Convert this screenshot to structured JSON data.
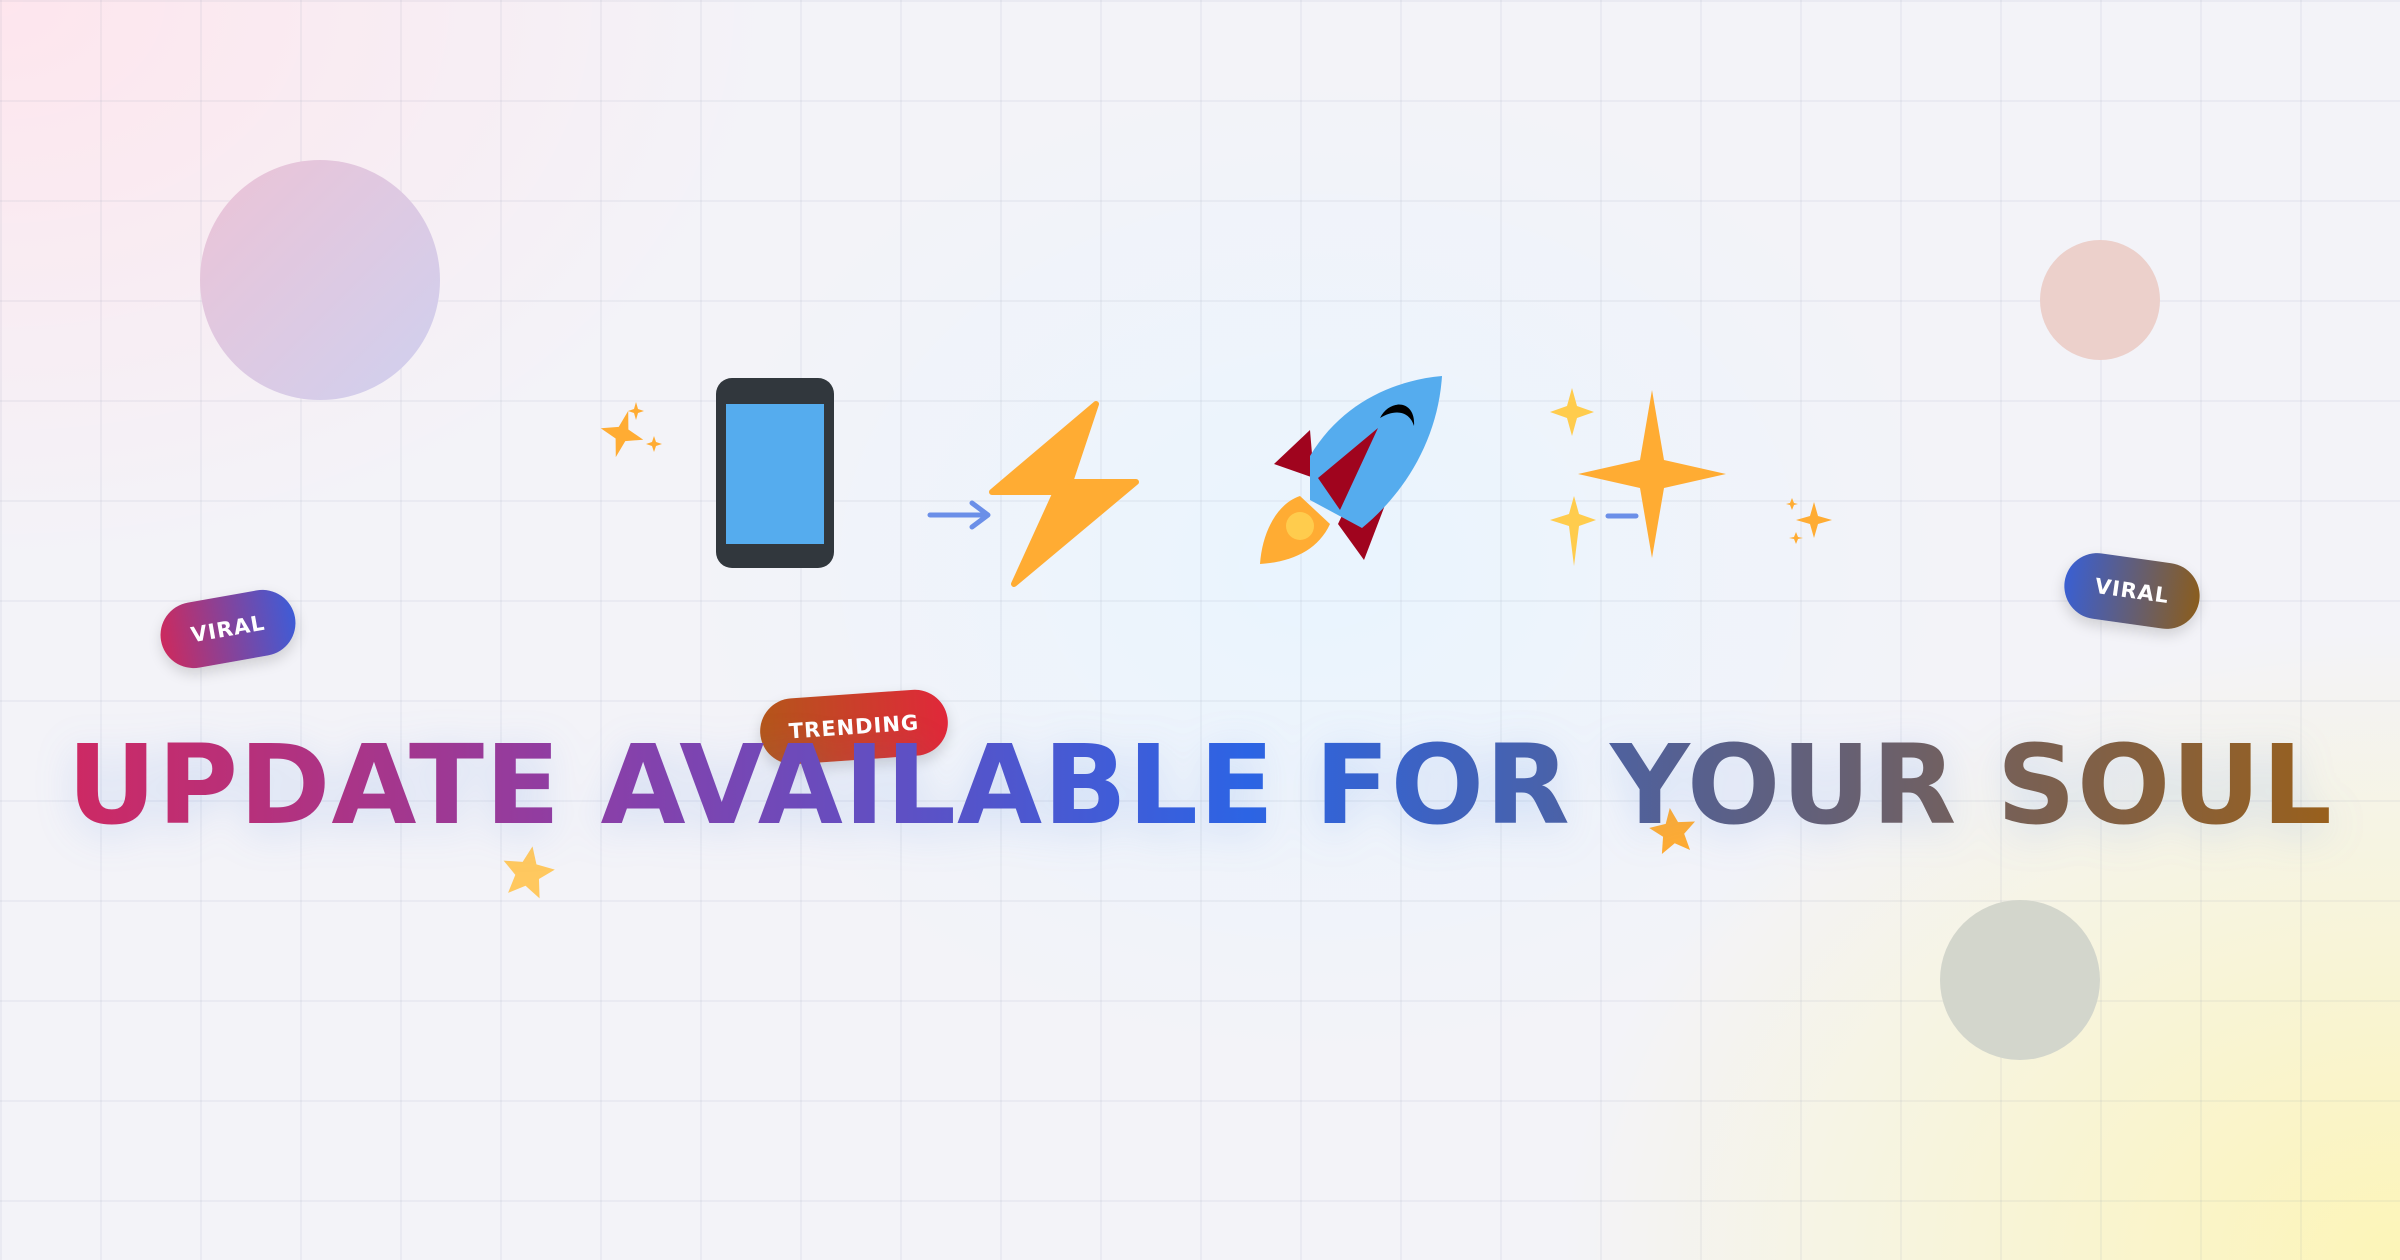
{
  "headline": "UPDATE AVAILABLE FOR YOUR SOUL",
  "badges": {
    "viral_left": "VIRAL",
    "viral_right": "VIRAL",
    "trending": "TRENDING"
  },
  "icons": [
    "sparkles-icon",
    "mobile-phone-icon",
    "arrow-right-icon",
    "lightning-bolt-icon",
    "rocket-icon",
    "sparkles-icon",
    "arrow-right-icon",
    "sparkles-icon",
    "star-icon"
  ],
  "colors": {
    "gradient_start": "#d6265a",
    "gradient_mid": "#2c64e4",
    "gradient_end": "#a06010",
    "accent_yellow": "#ffac33",
    "phone_screen": "#55acee"
  }
}
